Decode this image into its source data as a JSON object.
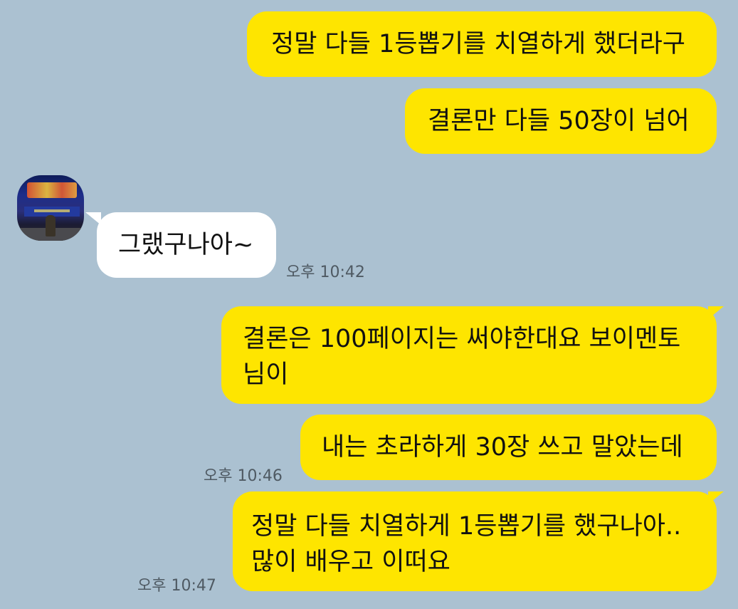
{
  "messages": [
    {
      "text": "정말 다들 1등뽑기를 치열하게 했더라구"
    },
    {
      "text": "결론만 다들 50장이 넘어"
    },
    {
      "text": "그랬구나아~",
      "time": "오후 10:42"
    },
    {
      "line1": "결론은 100페이지는 써야한대요 보이멘토",
      "line2": "님이"
    },
    {
      "text": "내는 초라하게 30장 쓰고 말았는데",
      "time": "오후 10:46"
    },
    {
      "line1": "정말 다들 치열하게 1등뽑기를 했구나아..",
      "line2": "많이 배우고 이떠요",
      "time": "오후 10:47"
    }
  ],
  "colors": {
    "background": "#abc1d1",
    "outgoing_bubble": "#fee500",
    "incoming_bubble": "#ffffff"
  },
  "icons": {
    "avatar": "profile-photo"
  }
}
